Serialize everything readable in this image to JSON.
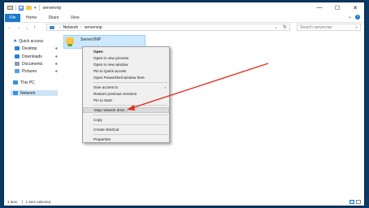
{
  "window": {
    "title": "servervnp"
  },
  "controls": {
    "minimize": "—",
    "maximize": "☐",
    "close": "✕"
  },
  "ribbon": {
    "file": "File",
    "home": "Home",
    "share": "Share",
    "view": "View",
    "expand": "⌄",
    "help": "?"
  },
  "address": {
    "crumbs": [
      "Network",
      "servervnp"
    ],
    "separator": "›",
    "dropdown": "⌄",
    "refresh": "↻"
  },
  "nav": {
    "back": "←",
    "forward": "→",
    "recent": "⌄",
    "up": "↑"
  },
  "search": {
    "placeholder": "Search servervnp",
    "icon": "⌕"
  },
  "sidebar": {
    "quick_access": "Quick access",
    "items": [
      {
        "label": "Desktop"
      },
      {
        "label": "Downloads"
      },
      {
        "label": "Documents"
      },
      {
        "label": "Pictures"
      }
    ],
    "this_pc": "This PC",
    "network": "Network",
    "pin": "✱"
  },
  "content": {
    "file_name": "ServerVNP"
  },
  "context_menu": {
    "open": "Open",
    "open_new_process": "Open in new process",
    "open_new_window": "Open in new window",
    "pin_quick": "Pin to Quick access",
    "open_powershell": "Open PowerShell window here",
    "give_access": "Give access to",
    "restore_versions": "Restore previous versions",
    "pin_start": "Pin to Start",
    "map_drive": "Map network drive...",
    "copy": "Copy",
    "create_shortcut": "Create shortcut",
    "properties": "Properties",
    "submenu_arrow": "›"
  },
  "status": {
    "count": "1 item",
    "selected": "1 item selected"
  },
  "colors": {
    "accent": "#1979ca",
    "annotation": "#e0301e",
    "selection": "#cce8ff"
  }
}
